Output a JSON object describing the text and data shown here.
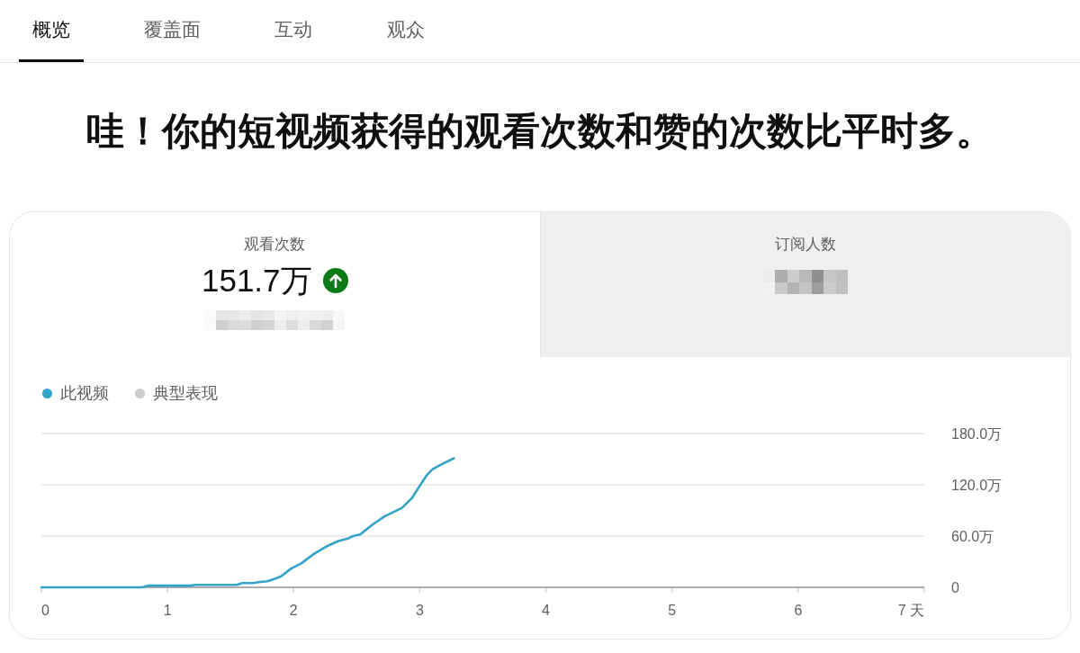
{
  "tabs": [
    {
      "label": "概览",
      "selected": true
    },
    {
      "label": "覆盖面",
      "selected": false
    },
    {
      "label": "互动",
      "selected": false
    },
    {
      "label": "观众",
      "selected": false
    }
  ],
  "headline": "哇！你的短视频获得的观看次数和赞的次数比平时多。",
  "stats": [
    {
      "label": "观看次数",
      "value": "151.7万",
      "rising": true,
      "selected": true,
      "note_blurred": true,
      "value_blurred": false
    },
    {
      "label": "订阅人数",
      "rising": false,
      "selected": false,
      "note_blurred": false,
      "value_blurred": true
    }
  ],
  "chart": {
    "chart_data": {
      "type": "line",
      "xlim": [
        0,
        7
      ],
      "ylim": [
        0,
        180
      ],
      "xticks": [
        0,
        1,
        2,
        3,
        4,
        5,
        6,
        {
          "value": 7,
          "label": "7 天"
        }
      ],
      "yticks": [
        0,
        {
          "value": 60,
          "label": "60.0万"
        },
        {
          "value": 120,
          "label": "120.0万"
        },
        {
          "value": 180,
          "label": "180.0万"
        }
      ],
      "x": [
        0,
        0.8,
        0.85,
        1.18,
        1.22,
        1.55,
        1.59,
        1.68,
        1.72,
        1.79,
        1.85,
        1.9,
        1.98,
        2.06,
        2.16,
        2.25,
        2.35,
        2.43,
        2.47,
        2.53,
        2.62,
        2.72,
        2.86,
        2.94,
        3.01,
        3.06,
        3.1,
        3.16,
        3.27
      ],
      "series": [
        {
          "name": "此视频",
          "color": "#33a3c8",
          "values": [
            0,
            0,
            2,
            2,
            3,
            3,
            5,
            5,
            6,
            7,
            10,
            13,
            22,
            28,
            39,
            47,
            54,
            57,
            60,
            62,
            73,
            83,
            93,
            105,
            121,
            132,
            138,
            143,
            151
          ]
        }
      ]
    },
    "benchmark_legend": {
      "label": "典型表现",
      "color": "#cccccc"
    }
  }
}
